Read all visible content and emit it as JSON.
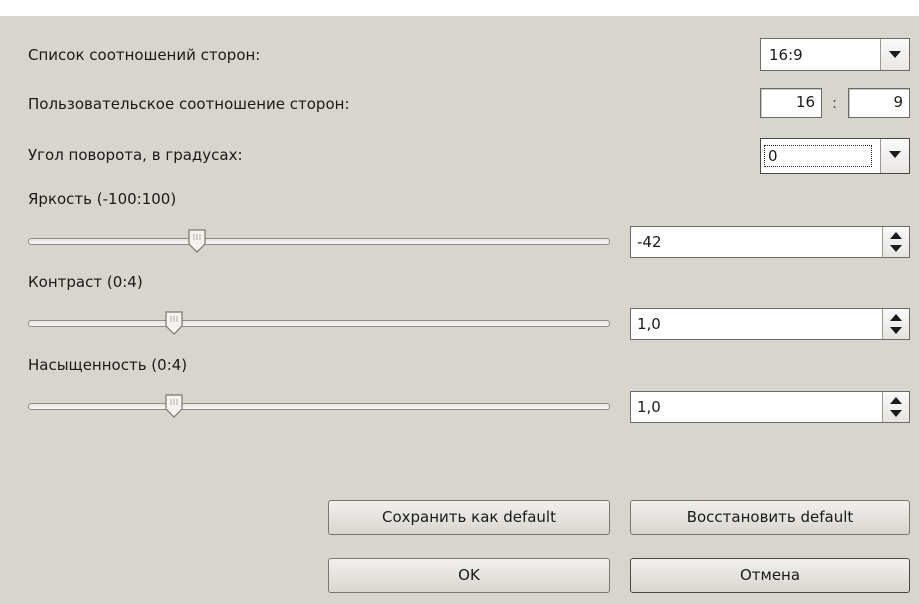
{
  "aspect_list": {
    "label": "Список соотношений сторон:",
    "value": "16:9"
  },
  "custom_ratio": {
    "label": "Пользовательское соотношение сторон:",
    "w": "16",
    "separator": ":",
    "h": "9"
  },
  "rotation": {
    "label": "Угол поворота, в градусах:",
    "value": "0"
  },
  "brightness": {
    "label": "Яркость (-100:100)",
    "value": "-42",
    "min": -100,
    "max": 100,
    "level": -42
  },
  "contrast": {
    "label": "Контраст (0:4)",
    "value": "1,0",
    "min": 0,
    "max": 4,
    "level": 1.0
  },
  "saturation": {
    "label": "Насыщенность (0:4)",
    "value": "1,0",
    "min": 0,
    "max": 4,
    "level": 1.0
  },
  "buttons": {
    "save_default": "Сохранить как default",
    "restore_default": "Восстановить default",
    "ok": "OK",
    "cancel": "Отмена"
  },
  "icons": [
    "dropdown-arrow-icon",
    "spin-up-icon",
    "spin-down-icon",
    "slider-thumb-icon"
  ]
}
